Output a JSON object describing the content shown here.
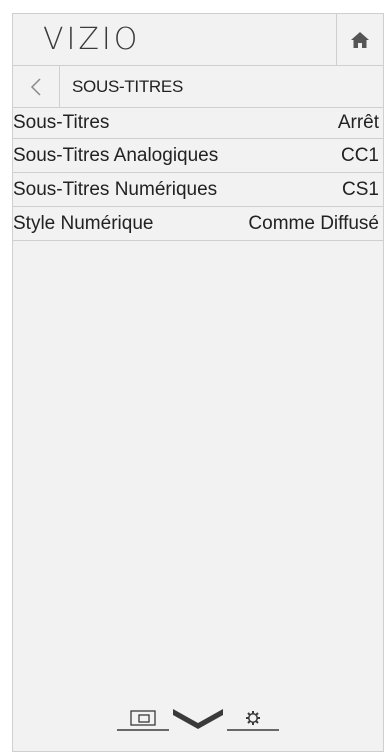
{
  "header": {
    "brand": "VIZIO",
    "home_icon": "home-icon"
  },
  "breadcrumb": {
    "back_icon": "back-arrow-icon",
    "title": "SOUS-TITRES"
  },
  "menu": {
    "items": [
      {
        "label": "Sous-Titres",
        "value": "Arrêt"
      },
      {
        "label": "Sous-Titres Analogiques",
        "value": "CC1"
      },
      {
        "label": "Sous-Titres Numériques",
        "value": "CS1"
      },
      {
        "label": "Style Numérique",
        "value": "Comme Diffusé"
      }
    ]
  },
  "footer": {
    "icons": [
      "input-icon",
      "chevron-down-icon",
      "settings-gear-icon"
    ]
  },
  "colors": {
    "panel_bg": "#f2f2f2",
    "divider": "#cfcfcf",
    "text": "#222222",
    "icon": "#3a3a3a"
  }
}
